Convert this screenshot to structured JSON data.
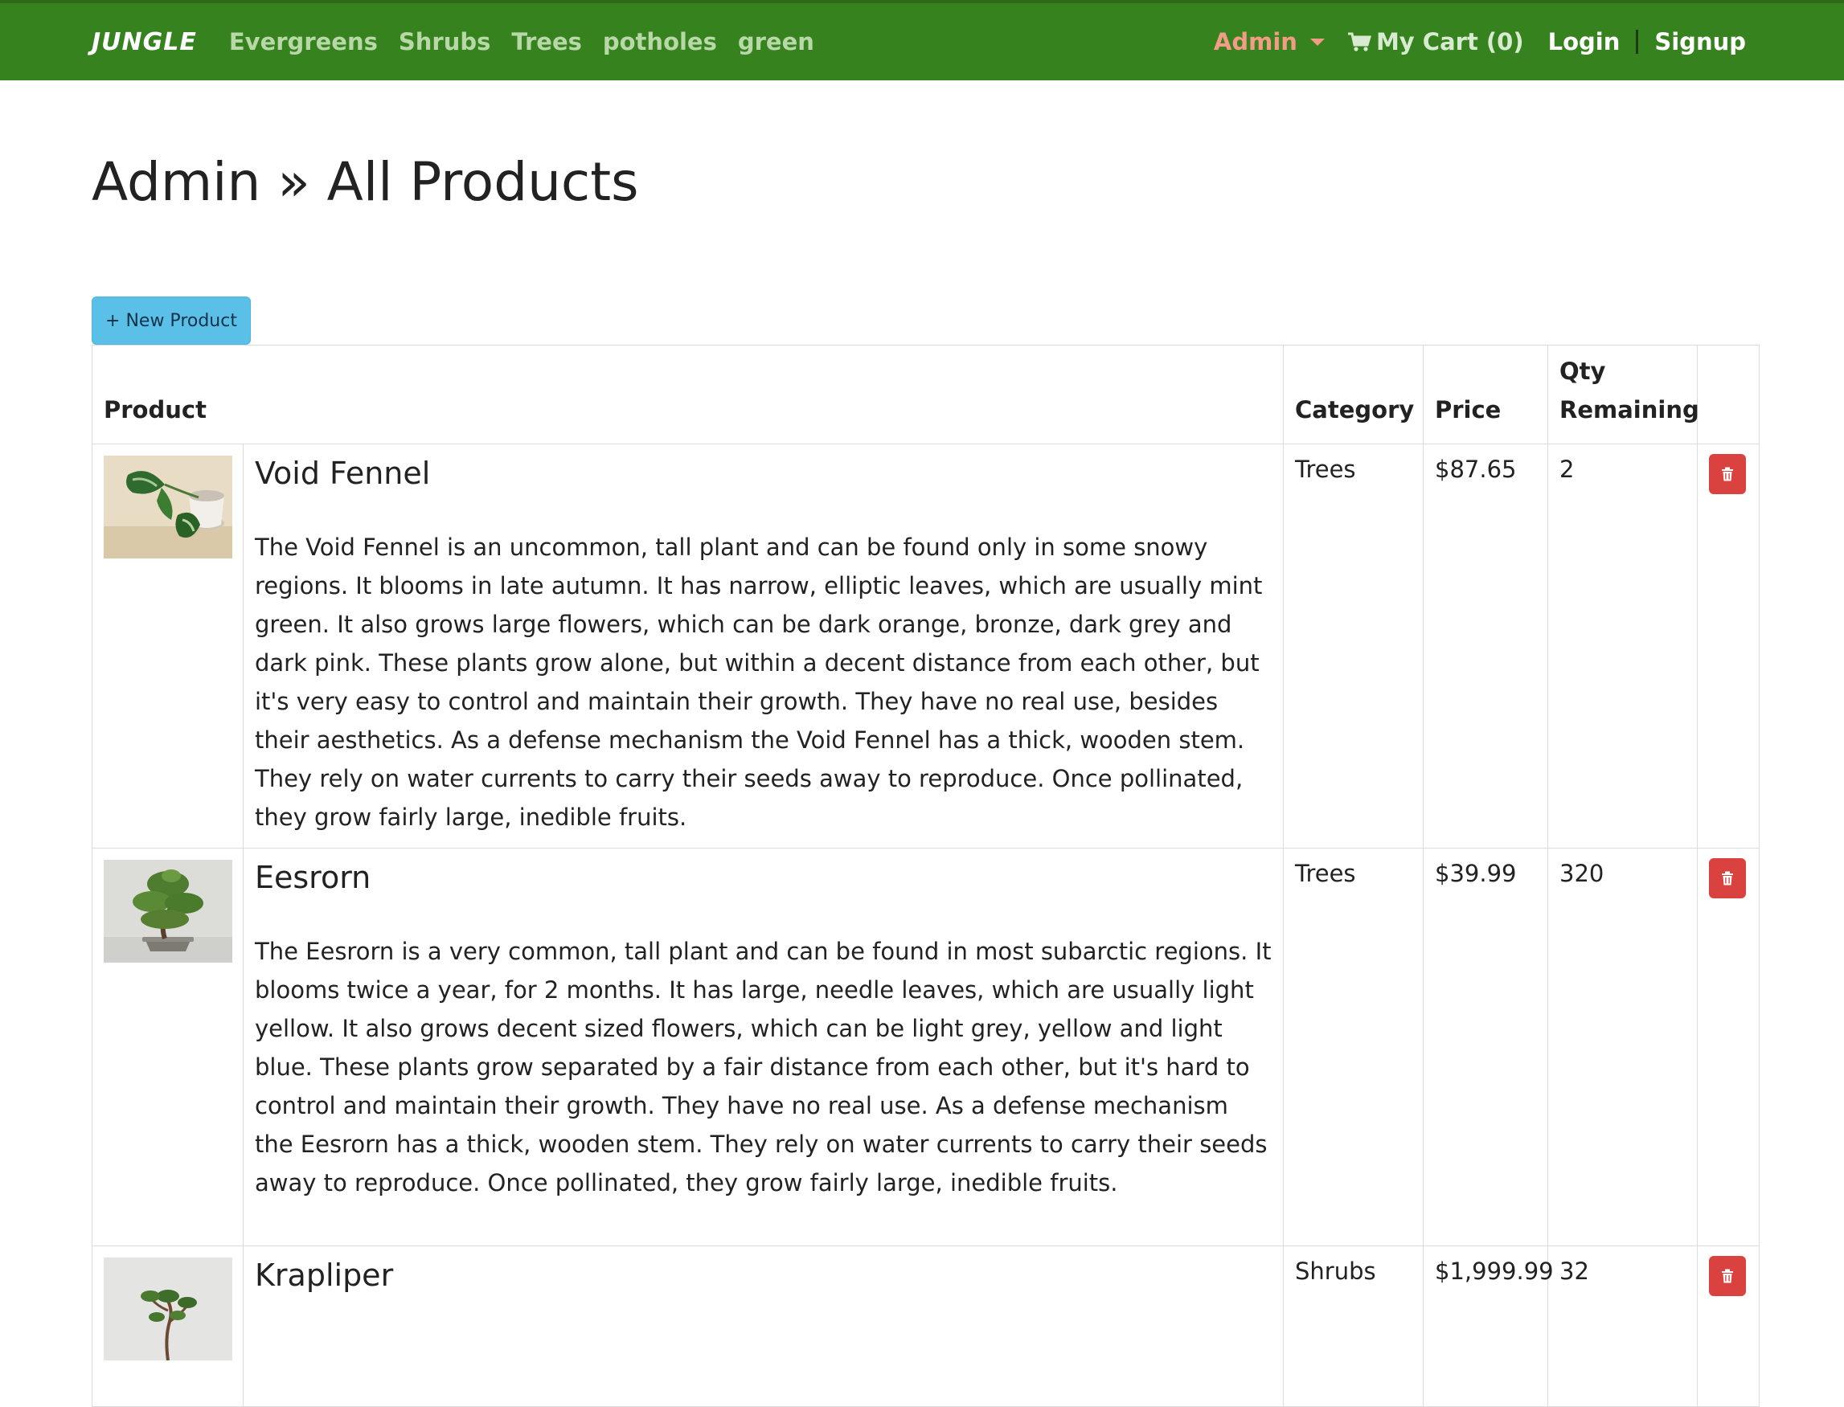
{
  "navbar": {
    "brand": "JUNGLE",
    "links": [
      "Evergreens",
      "Shrubs",
      "Trees",
      "potholes",
      "green"
    ],
    "admin_label": "Admin",
    "cart_label": "My Cart (0)",
    "login_label": "Login",
    "signup_label": "Signup",
    "colors": {
      "background": "#36821f",
      "admin": "#f39c85"
    }
  },
  "page": {
    "title": "Admin » All Products"
  },
  "new_product_label": "+ New Product",
  "table": {
    "headers": {
      "product": "Product",
      "category": "Category",
      "price": "Price",
      "qty_line1": "Qty",
      "qty_line2": "Remaining"
    },
    "rows": [
      {
        "name": "Void Fennel",
        "description": "The Void Fennel is an uncommon, tall plant and can be found only in some snowy regions. It blooms in late autumn. It has narrow, elliptic leaves, which are usually mint green. It also grows large flowers, which can be dark orange, bronze, dark grey and dark pink. These plants grow alone, but within a decent distance from each other, but it's very easy to control and maintain their growth. They have no real use, besides their aesthetics. As a defense mechanism the Void Fennel has a thick, wooden stem. They rely on water currents to carry their seeds away to reproduce. Once pollinated, they grow fairly large, inedible fruits.",
        "category": "Trees",
        "price": "$87.65",
        "qty": "2",
        "image": "pothos-plant-image"
      },
      {
        "name": "Eesrorn",
        "description": "The Eesrorn is a very common, tall plant and can be found in most subarctic regions. It blooms twice a year, for 2 months. It has large, needle leaves, which are usually light yellow. It also grows decent sized flowers, which can be light grey, yellow and light blue. These plants grow separated by a fair distance from each other, but it's hard to control and maintain their growth. They have no real use. As a defense mechanism the Eesrorn has a thick, wooden stem. They rely on water currents to carry their seeds away to reproduce. Once pollinated, they grow fairly large, inedible fruits.",
        "category": "Trees",
        "price": "$39.99",
        "qty": "320",
        "image": "bonsai-tree-image"
      },
      {
        "name": "Krapliper",
        "description": "",
        "category": "Shrubs",
        "price": "$1,999.99",
        "qty": "32",
        "image": "small-bonsai-image"
      }
    ]
  },
  "icons": {
    "cart": "shopping-cart-icon",
    "delete": "trash-icon",
    "dropdown": "caret-down-icon"
  }
}
